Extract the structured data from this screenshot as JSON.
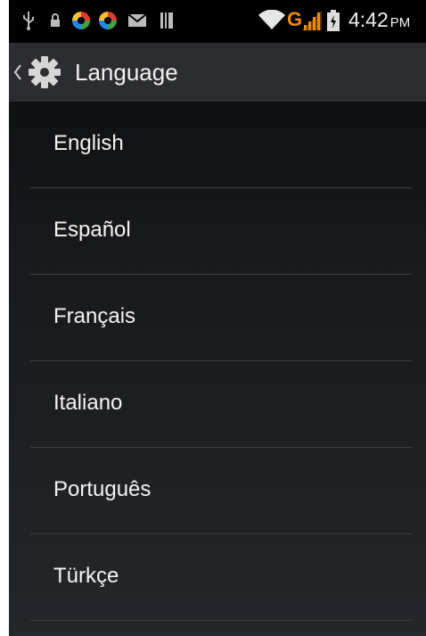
{
  "status_bar": {
    "network_type": "G",
    "time": "4:42",
    "ampm": "PM",
    "icons": [
      "usb-icon",
      "lock-icon",
      "spinner-icon",
      "spinner-icon",
      "mail-icon",
      "sd-card-icon",
      "wifi-icon",
      "signal-icon",
      "battery-icon"
    ],
    "colors": {
      "network_type": "#f08a00",
      "signal": "#f08a00",
      "spinner": [
        "#e53935",
        "#43a047",
        "#1e88e5",
        "#fbc02d"
      ]
    }
  },
  "action_bar": {
    "title": "Language",
    "back_icon": "chevron-left-icon",
    "app_icon": "gear-icon"
  },
  "languages": [
    {
      "label": "English"
    },
    {
      "label": "Español"
    },
    {
      "label": "Français"
    },
    {
      "label": "Italiano"
    },
    {
      "label": "Português"
    },
    {
      "label": "Türkçe"
    }
  ]
}
